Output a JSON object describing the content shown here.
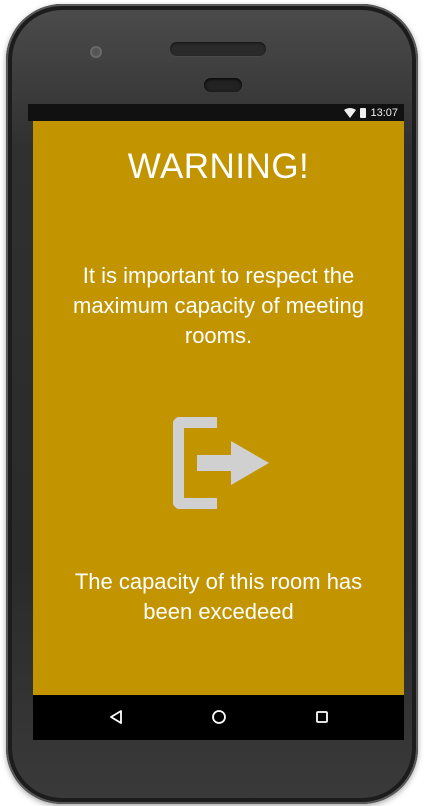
{
  "status_bar": {
    "time": "13:07",
    "icons": [
      "wifi-icon",
      "battery-icon"
    ]
  },
  "screen": {
    "background_color": "#c19400",
    "title": "WARNING!",
    "message": "It is important to respect the maximum capacity of meeting rooms.",
    "icon": "exit-icon",
    "footer": "The capacity of this room has been excedeed"
  },
  "navigation": {
    "buttons": [
      "back-icon",
      "home-icon",
      "recent-apps-icon"
    ]
  }
}
